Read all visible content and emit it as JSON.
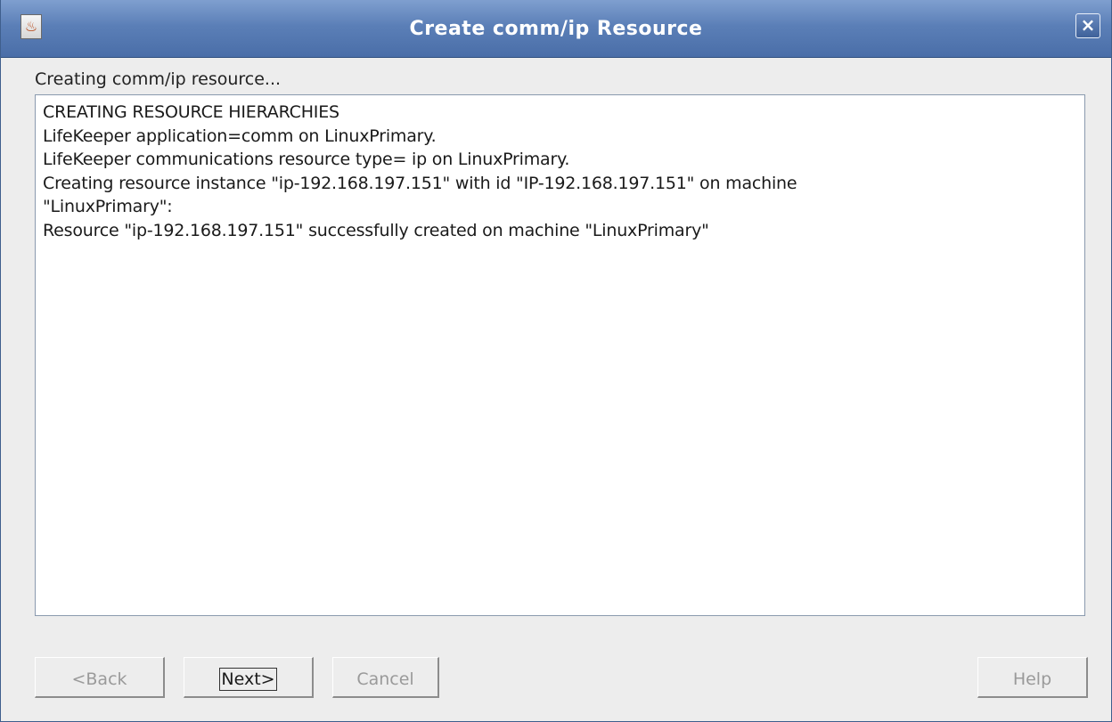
{
  "window": {
    "title": "Create comm/ip Resource",
    "app_icon": "java-icon",
    "close_label": "×"
  },
  "status": {
    "text": "Creating comm/ip resource..."
  },
  "log": {
    "lines": [
      "CREATING RESOURCE HIERARCHIES",
      "LifeKeeper application=comm on LinuxPrimary.",
      "LifeKeeper communications resource type= ip on LinuxPrimary.",
      "Creating resource instance \"ip-192.168.197.151\" with id \"IP-192.168.197.151\" on machine",
      "\"LinuxPrimary\":",
      "Resource \"ip-192.168.197.151\" successfully created on machine \"LinuxPrimary\""
    ]
  },
  "buttons": {
    "back": "<Back",
    "next": "Next>",
    "cancel": "Cancel",
    "help": "Help"
  },
  "colors": {
    "titlebar": "#5b7fb7",
    "background": "#ededed",
    "disabled_text": "#9a9a9a"
  }
}
